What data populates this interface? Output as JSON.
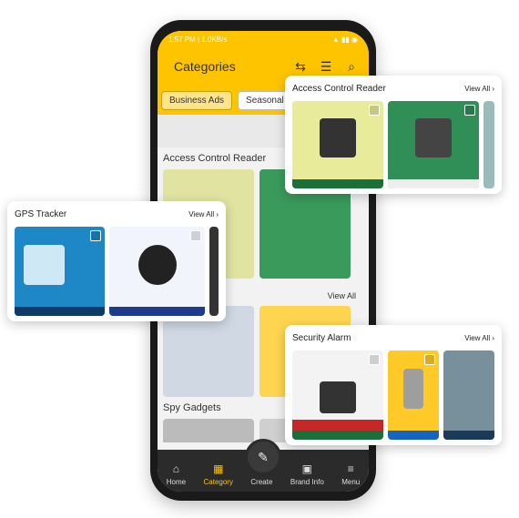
{
  "phone": {
    "status_time": "1:57 PM | 1.0KB/s",
    "app_title": "Categories",
    "chips": [
      "Business Ads",
      "Seasonal B"
    ],
    "sections": [
      "Access Control Reader",
      "Spy Gadgets"
    ],
    "inner_view_all": "View All",
    "nav": [
      "Home",
      "Category",
      "Create",
      "Brand Info",
      "Menu"
    ]
  },
  "cards": {
    "access": {
      "title": "Access Control Reader",
      "view_all": "View All"
    },
    "gps": {
      "title": "GPS Tracker",
      "view_all": "View All"
    },
    "security": {
      "title": "Security Alarm",
      "view_all": "View All"
    }
  },
  "colors": {
    "brand_yellow": "#ffc400",
    "nav_dark": "#2b2b2b",
    "accent_green": "#1b6f3a",
    "accent_red": "#c62828"
  }
}
